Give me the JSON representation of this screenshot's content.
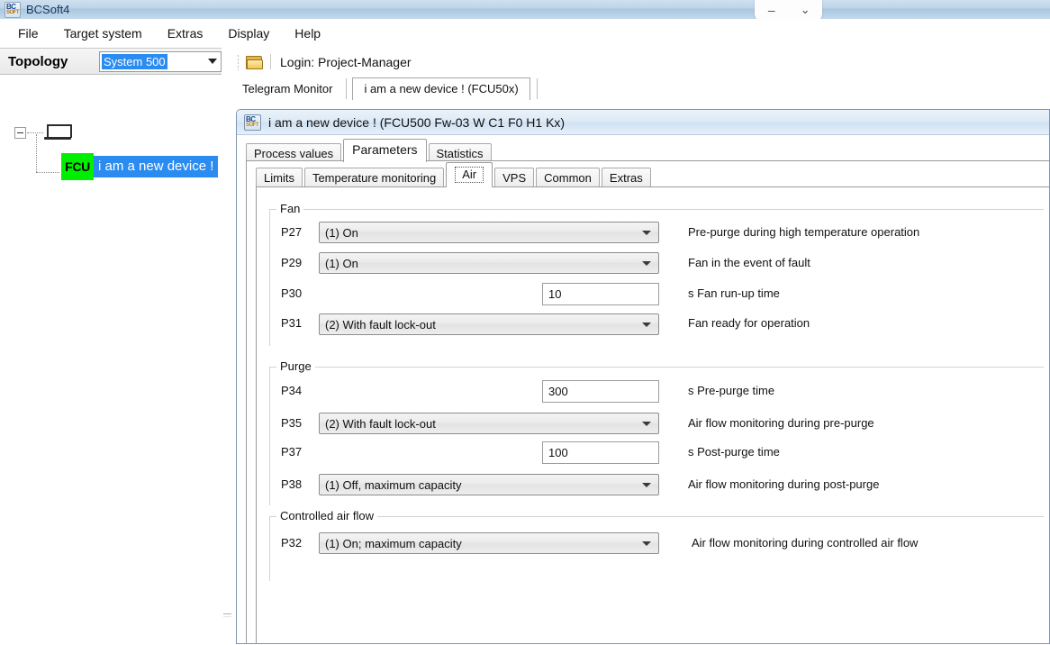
{
  "window": {
    "title": "BCSoft4",
    "app_icon": "bcsoft-logo-icon",
    "controls": {
      "minimize": "–",
      "chevron": "⌄"
    }
  },
  "menubar": {
    "items": [
      "File",
      "Target system",
      "Extras",
      "Display",
      "Help"
    ]
  },
  "topology": {
    "title": "Topology",
    "system_combo": {
      "value": "System 500",
      "arrow": "chevron-down-icon"
    },
    "tree": {
      "root_icon": "computer-icon",
      "child": {
        "badge": "FCU",
        "label": "i am a new device !"
      }
    }
  },
  "toolbar": {
    "open_icon": "open-folder-icon",
    "login_label": "Login: Project-Manager"
  },
  "tabstrip": {
    "telegram_monitor": "Telegram Monitor",
    "active_device_tab": "i am a new device !  (FCU50x)"
  },
  "document": {
    "icon": "bcsoft-logo-icon",
    "title": "i am a new device !  (FCU500 Fw-03 W C1 F0 H1 Kx)",
    "tabs": [
      {
        "label": "Process values",
        "selected": false
      },
      {
        "label": "Parameters",
        "selected": true
      },
      {
        "label": "Statistics",
        "selected": false
      }
    ],
    "subtabs": [
      {
        "label": "Limits",
        "selected": false
      },
      {
        "label": "Temperature monitoring",
        "selected": false
      },
      {
        "label": "Air",
        "selected": true
      },
      {
        "label": "VPS",
        "selected": false
      },
      {
        "label": "Common",
        "selected": false
      },
      {
        "label": "Extras",
        "selected": false
      }
    ]
  },
  "groups": {
    "fan": {
      "label": "Fan",
      "rows": [
        {
          "code": "P27",
          "type": "combo",
          "value": "(1) On",
          "desc": "Pre-purge during high temperature operation"
        },
        {
          "code": "P29",
          "type": "combo",
          "value": "(1) On",
          "desc": "Fan in the event of fault"
        },
        {
          "code": "P30",
          "type": "number",
          "value": "10",
          "desc": "s Fan run-up time"
        },
        {
          "code": "P31",
          "type": "combo",
          "value": "(2) With fault lock-out",
          "desc": "Fan ready for operation"
        }
      ]
    },
    "purge": {
      "label": "Purge",
      "rows": [
        {
          "code": "P34",
          "type": "number",
          "value": "300",
          "desc": "s Pre-purge time"
        },
        {
          "code": "P35",
          "type": "combo",
          "value": "(2) With fault lock-out",
          "desc": "Air flow monitoring during pre-purge"
        },
        {
          "code": "P37",
          "type": "number",
          "value": "100",
          "desc": "s Post-purge time"
        },
        {
          "code": "P38",
          "type": "combo",
          "value": "(1) Off, maximum capacity",
          "desc": "Air flow monitoring during post-purge"
        }
      ]
    },
    "controlled_air_flow": {
      "label": "Controlled air flow",
      "rows": [
        {
          "code": "P32",
          "type": "combo",
          "value": "(1) On; maximum capacity",
          "desc": "Air flow monitoring during controlled air flow"
        }
      ]
    }
  }
}
